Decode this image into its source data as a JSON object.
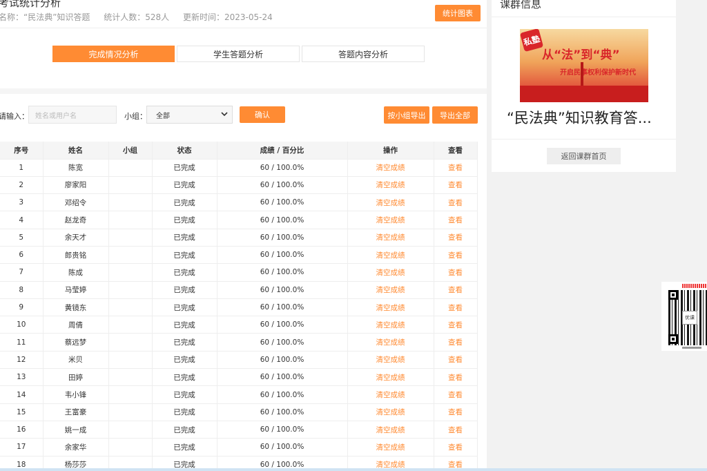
{
  "header": {
    "title": "考试统计分析",
    "name_label": "名称：“民法典”知识答题",
    "count_label": "统计人数：528人",
    "updated_label": "更新时间：2023-05-24",
    "chart_button": "统计图表"
  },
  "tabs": [
    {
      "label": "完成情况分析",
      "active": true
    },
    {
      "label": "学生答题分析",
      "active": false
    },
    {
      "label": "答题内容分析",
      "active": false
    }
  ],
  "filters": {
    "search_label": "请输入：",
    "search_placeholder": "姓名或用户名",
    "group_label": "小组：",
    "group_value": "全部",
    "confirm_button": "确认",
    "group_export_button": "按小组导出",
    "export_all_button": "导出全部"
  },
  "table": {
    "headers": [
      "序号",
      "姓名",
      "小组",
      "状态",
      "成绩 / 百分比",
      "操作",
      "查看"
    ],
    "rows": [
      {
        "no": "1",
        "name": "陈宽",
        "group": "",
        "status": "已完成",
        "score": "60 / 100.0%",
        "action": "清空成绩",
        "view": "查看"
      },
      {
        "no": "2",
        "name": "廖家阳",
        "group": "",
        "status": "已完成",
        "score": "60 / 100.0%",
        "action": "清空成绩",
        "view": "查看"
      },
      {
        "no": "3",
        "name": "邓绍令",
        "group": "",
        "status": "已完成",
        "score": "60 / 100.0%",
        "action": "清空成绩",
        "view": "查看"
      },
      {
        "no": "4",
        "name": "赵龙奇",
        "group": "",
        "status": "已完成",
        "score": "60 / 100.0%",
        "action": "清空成绩",
        "view": "查看"
      },
      {
        "no": "5",
        "name": "余天才",
        "group": "",
        "status": "已完成",
        "score": "60 / 100.0%",
        "action": "清空成绩",
        "view": "查看"
      },
      {
        "no": "6",
        "name": "郎贵铭",
        "group": "",
        "status": "已完成",
        "score": "60 / 100.0%",
        "action": "清空成绩",
        "view": "查看"
      },
      {
        "no": "7",
        "name": "陈成",
        "group": "",
        "status": "已完成",
        "score": "60 / 100.0%",
        "action": "清空成绩",
        "view": "查看"
      },
      {
        "no": "8",
        "name": "马莹婷",
        "group": "",
        "status": "已完成",
        "score": "60 / 100.0%",
        "action": "清空成绩",
        "view": "查看"
      },
      {
        "no": "9",
        "name": "黄镜东",
        "group": "",
        "status": "已完成",
        "score": "60 / 100.0%",
        "action": "清空成绩",
        "view": "查看"
      },
      {
        "no": "10",
        "name": "周倩",
        "group": "",
        "status": "已完成",
        "score": "60 / 100.0%",
        "action": "清空成绩",
        "view": "查看"
      },
      {
        "no": "11",
        "name": "蔡远梦",
        "group": "",
        "status": "已完成",
        "score": "60 / 100.0%",
        "action": "清空成绩",
        "view": "查看"
      },
      {
        "no": "12",
        "name": "米贝",
        "group": "",
        "status": "已完成",
        "score": "60 / 100.0%",
        "action": "清空成绩",
        "view": "查看"
      },
      {
        "no": "13",
        "name": "田婷",
        "group": "",
        "status": "已完成",
        "score": "60 / 100.0%",
        "action": "清空成绩",
        "view": "查看"
      },
      {
        "no": "14",
        "name": "韦小锋",
        "group": "",
        "status": "已完成",
        "score": "60 / 100.0%",
        "action": "清空成绩",
        "view": "查看"
      },
      {
        "no": "15",
        "name": "王富豪",
        "group": "",
        "status": "已完成",
        "score": "60 / 100.0%",
        "action": "清空成绩",
        "view": "查看"
      },
      {
        "no": "16",
        "name": "姚一成",
        "group": "",
        "status": "已完成",
        "score": "60 / 100.0%",
        "action": "清空成绩",
        "view": "查看"
      },
      {
        "no": "17",
        "name": "余家华",
        "group": "",
        "status": "已完成",
        "score": "60 / 100.0%",
        "action": "清空成绩",
        "view": "查看"
      },
      {
        "no": "18",
        "name": "杨莎莎",
        "group": "",
        "status": "已完成",
        "score": "60 / 100.0%",
        "action": "清空成绩",
        "view": "查看"
      }
    ]
  },
  "side": {
    "title": "课群信息",
    "banner_stamp": "私塾",
    "banner_headline": "从“法”到“典”",
    "banner_subline": "开启民事权利保护新时代",
    "course_name": "“民法典”知识教育答...",
    "back_button": "返回课群首页"
  },
  "qr": {
    "logo_text": "优课"
  },
  "colors": {
    "accent": "#ff8b33",
    "header_bg": "#f5f5f5",
    "page_bg": "#f2f2f2"
  }
}
